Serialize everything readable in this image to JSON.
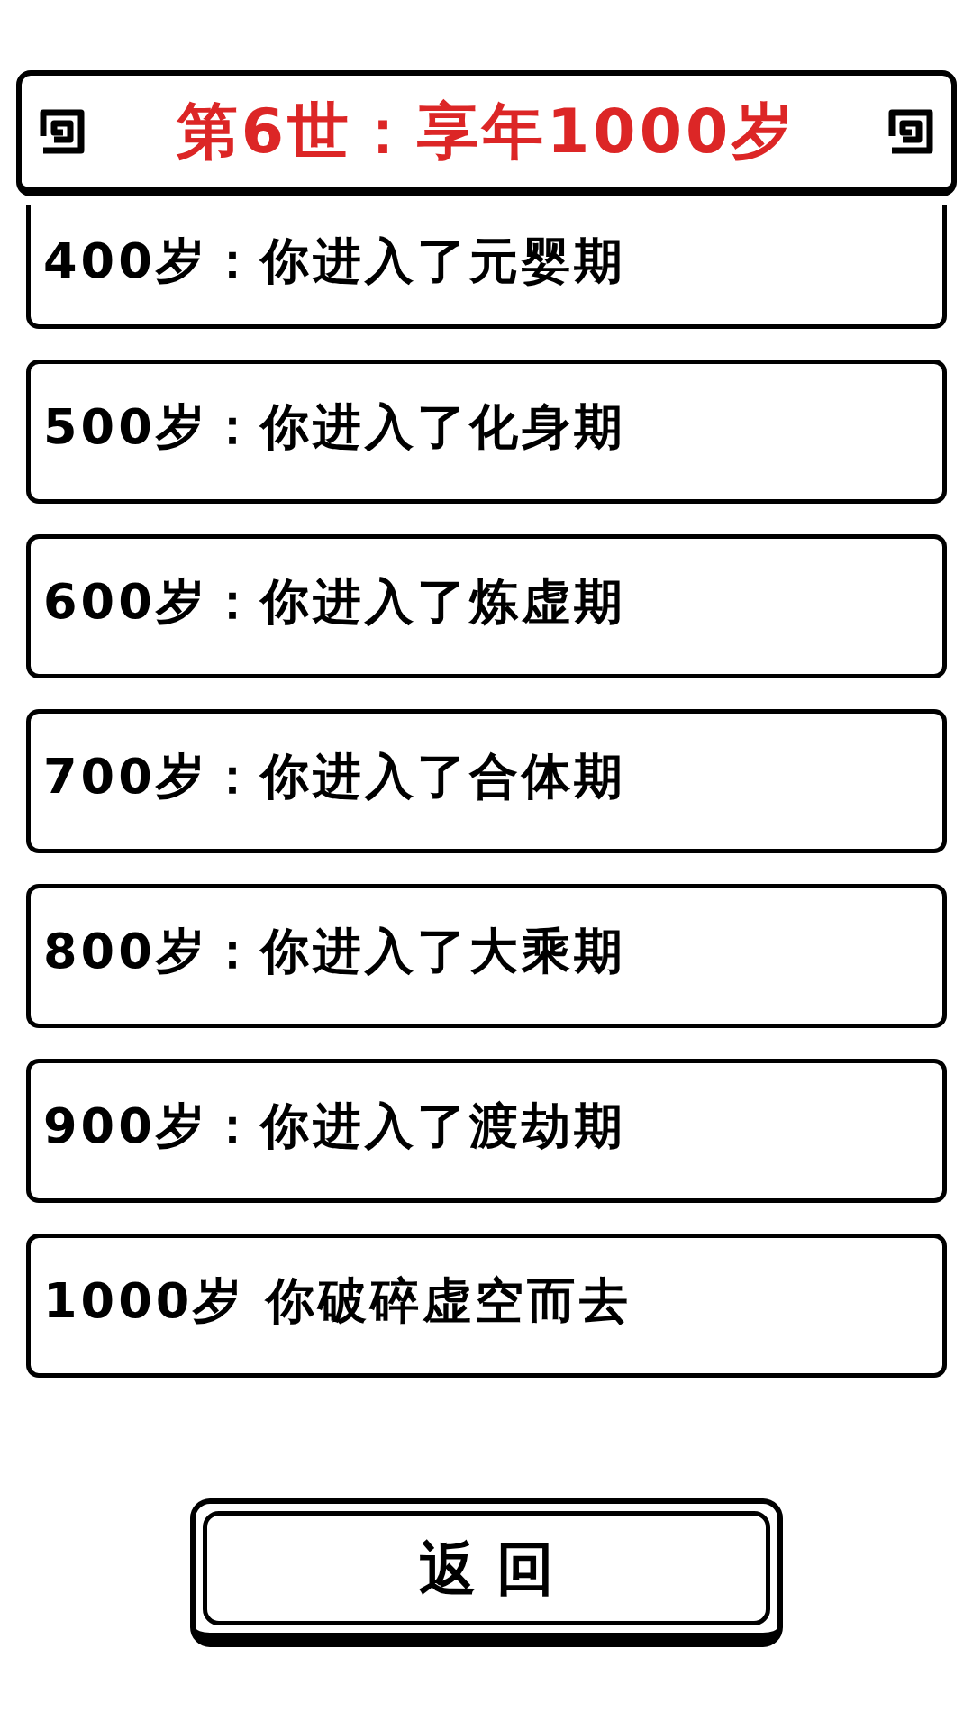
{
  "header": {
    "title": "第6世：享年1000岁"
  },
  "events": [
    "400岁：你进入了元婴期",
    "500岁：你进入了化身期",
    "600岁：你进入了炼虚期",
    "700岁：你进入了合体期",
    "800岁：你进入了大乘期",
    "900岁：你进入了渡劫期",
    "1000岁 你破碎虚空而去"
  ],
  "back_button": {
    "label": "返 回"
  }
}
